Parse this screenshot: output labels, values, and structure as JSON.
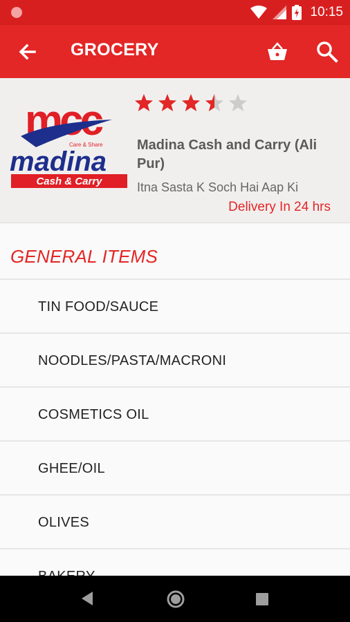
{
  "status_bar": {
    "time": "10:15"
  },
  "app_bar": {
    "title": "GROCERY"
  },
  "store": {
    "logo": {
      "brand_top": "mcc",
      "slogan": "Care & Share",
      "brand_main": "madina",
      "brand_sub": "Cash & Carry"
    },
    "rating": 3.5,
    "name": "Madina Cash and Carry (Ali Pur)",
    "tagline": "Itna Sasta K Soch Hai Aap Ki",
    "delivery": "Delivery In 24 hrs"
  },
  "section": {
    "title": "GENERAL ITEMS",
    "items": [
      {
        "label": "TIN FOOD/SAUCE"
      },
      {
        "label": "NOODLES/PASTA/MACRONI"
      },
      {
        "label": "COSMETICS OIL"
      },
      {
        "label": "GHEE/OIL"
      },
      {
        "label": "OLIVES"
      },
      {
        "label": "BAKERY"
      }
    ]
  },
  "colors": {
    "primary": "#e32626",
    "status": "#d81f1f",
    "star": "#e32626",
    "star_empty": "#cccccc"
  },
  "icons": [
    "wifi-icon",
    "signal-icon",
    "battery-icon",
    "back-arrow-icon",
    "basket-icon",
    "search-icon",
    "nav-back-icon",
    "nav-home-icon",
    "nav-recent-icon"
  ]
}
